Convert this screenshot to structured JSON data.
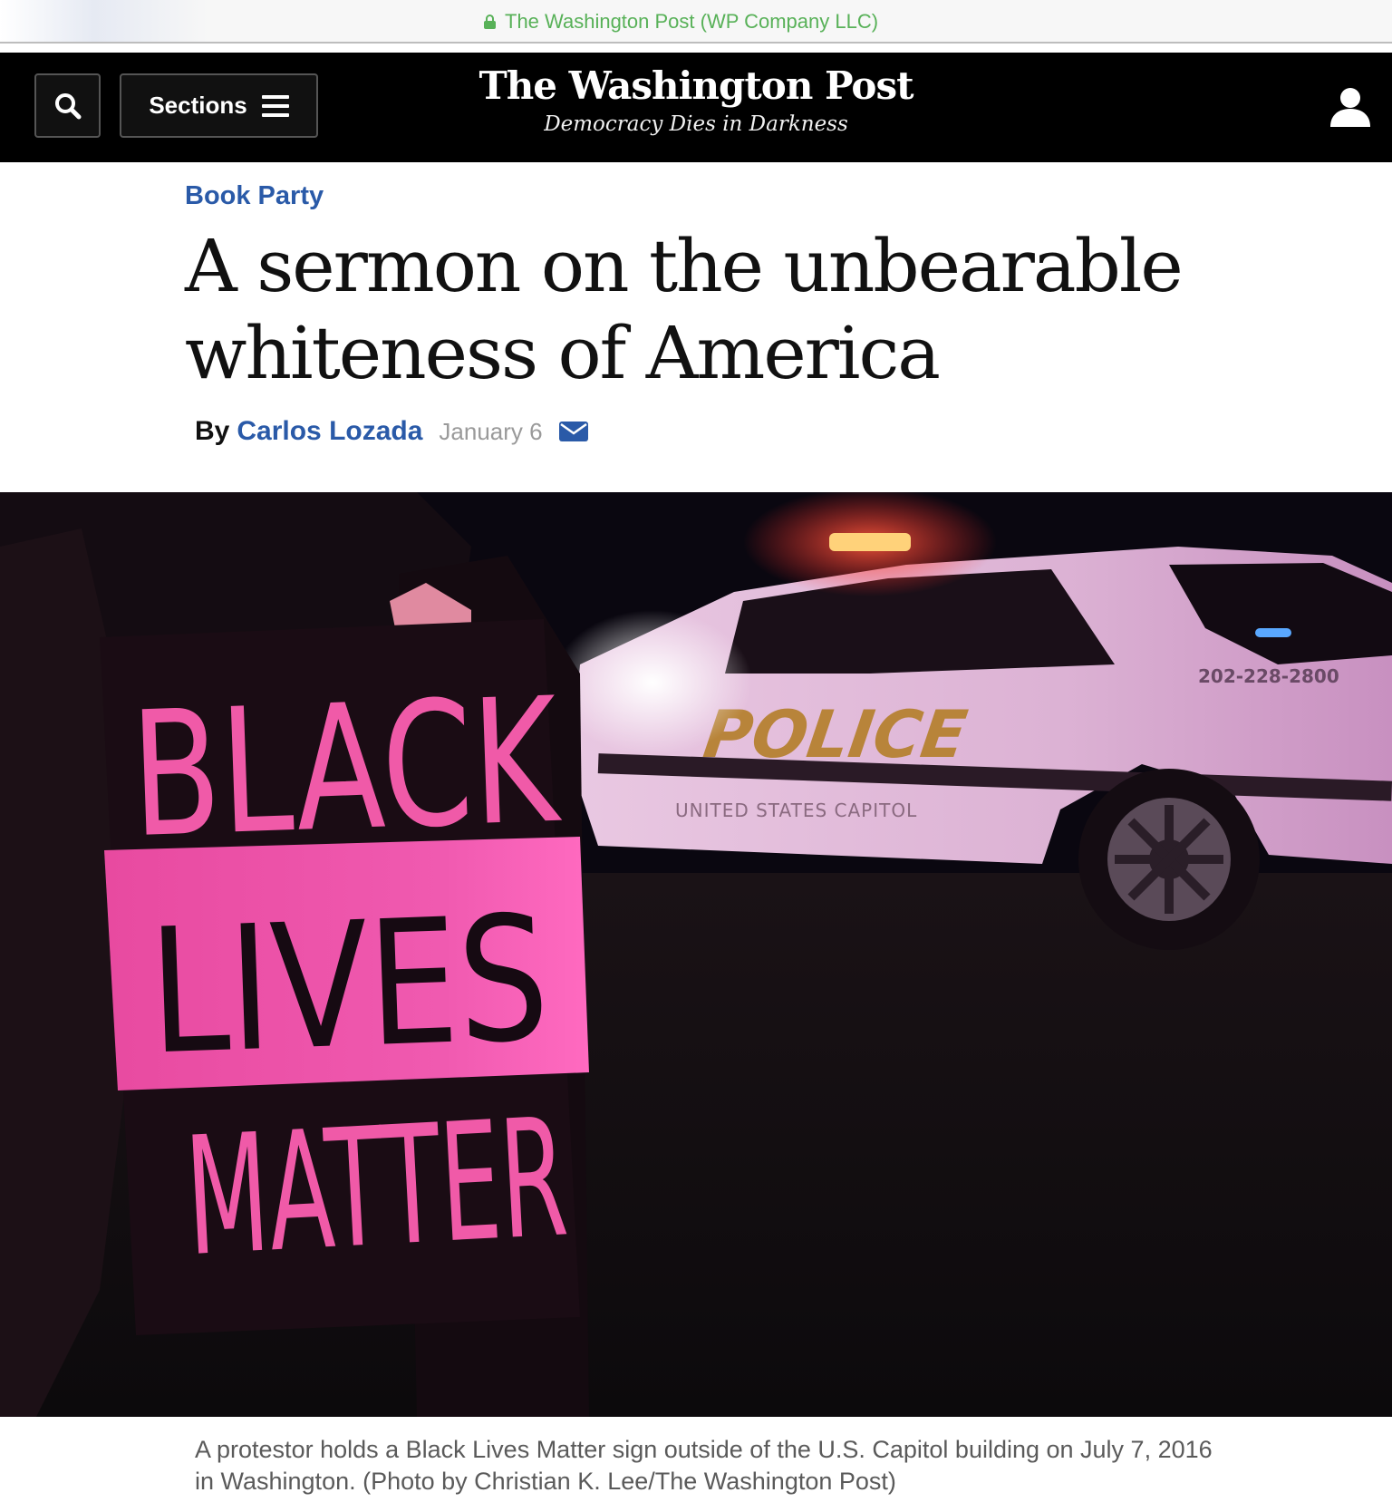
{
  "browser": {
    "url_label": "The Washington Post (WP Company LLC)"
  },
  "header": {
    "sections_label": "Sections",
    "logo_text": "The Washington Post",
    "tagline": "Democracy Dies in Darkness",
    "icons": [
      "search-icon",
      "hamburger-icon",
      "user-icon"
    ]
  },
  "article": {
    "kicker": "Book Party",
    "headline": "A sermon on the unbearable whiteness of America",
    "by_label": "By",
    "author": "Carlos Lozada",
    "date": "January 6",
    "photo": {
      "sign_lines": [
        "BLACK",
        "LIVES",
        "MATTER"
      ],
      "vehicle_text": "POLICE",
      "vehicle_subtext": "UNITED STATES CAPITOL",
      "vehicle_phone": "202-228-2800"
    },
    "caption": "A protestor holds a Black Lives Matter sign outside of the U.S. Capitol building on July 7, 2016 in Washington. (Photo by Christian K. Lee/The Washington Post)"
  },
  "colors": {
    "link_blue": "#2a5aa8",
    "header_bg": "#000000",
    "secure_green": "#58b158"
  }
}
